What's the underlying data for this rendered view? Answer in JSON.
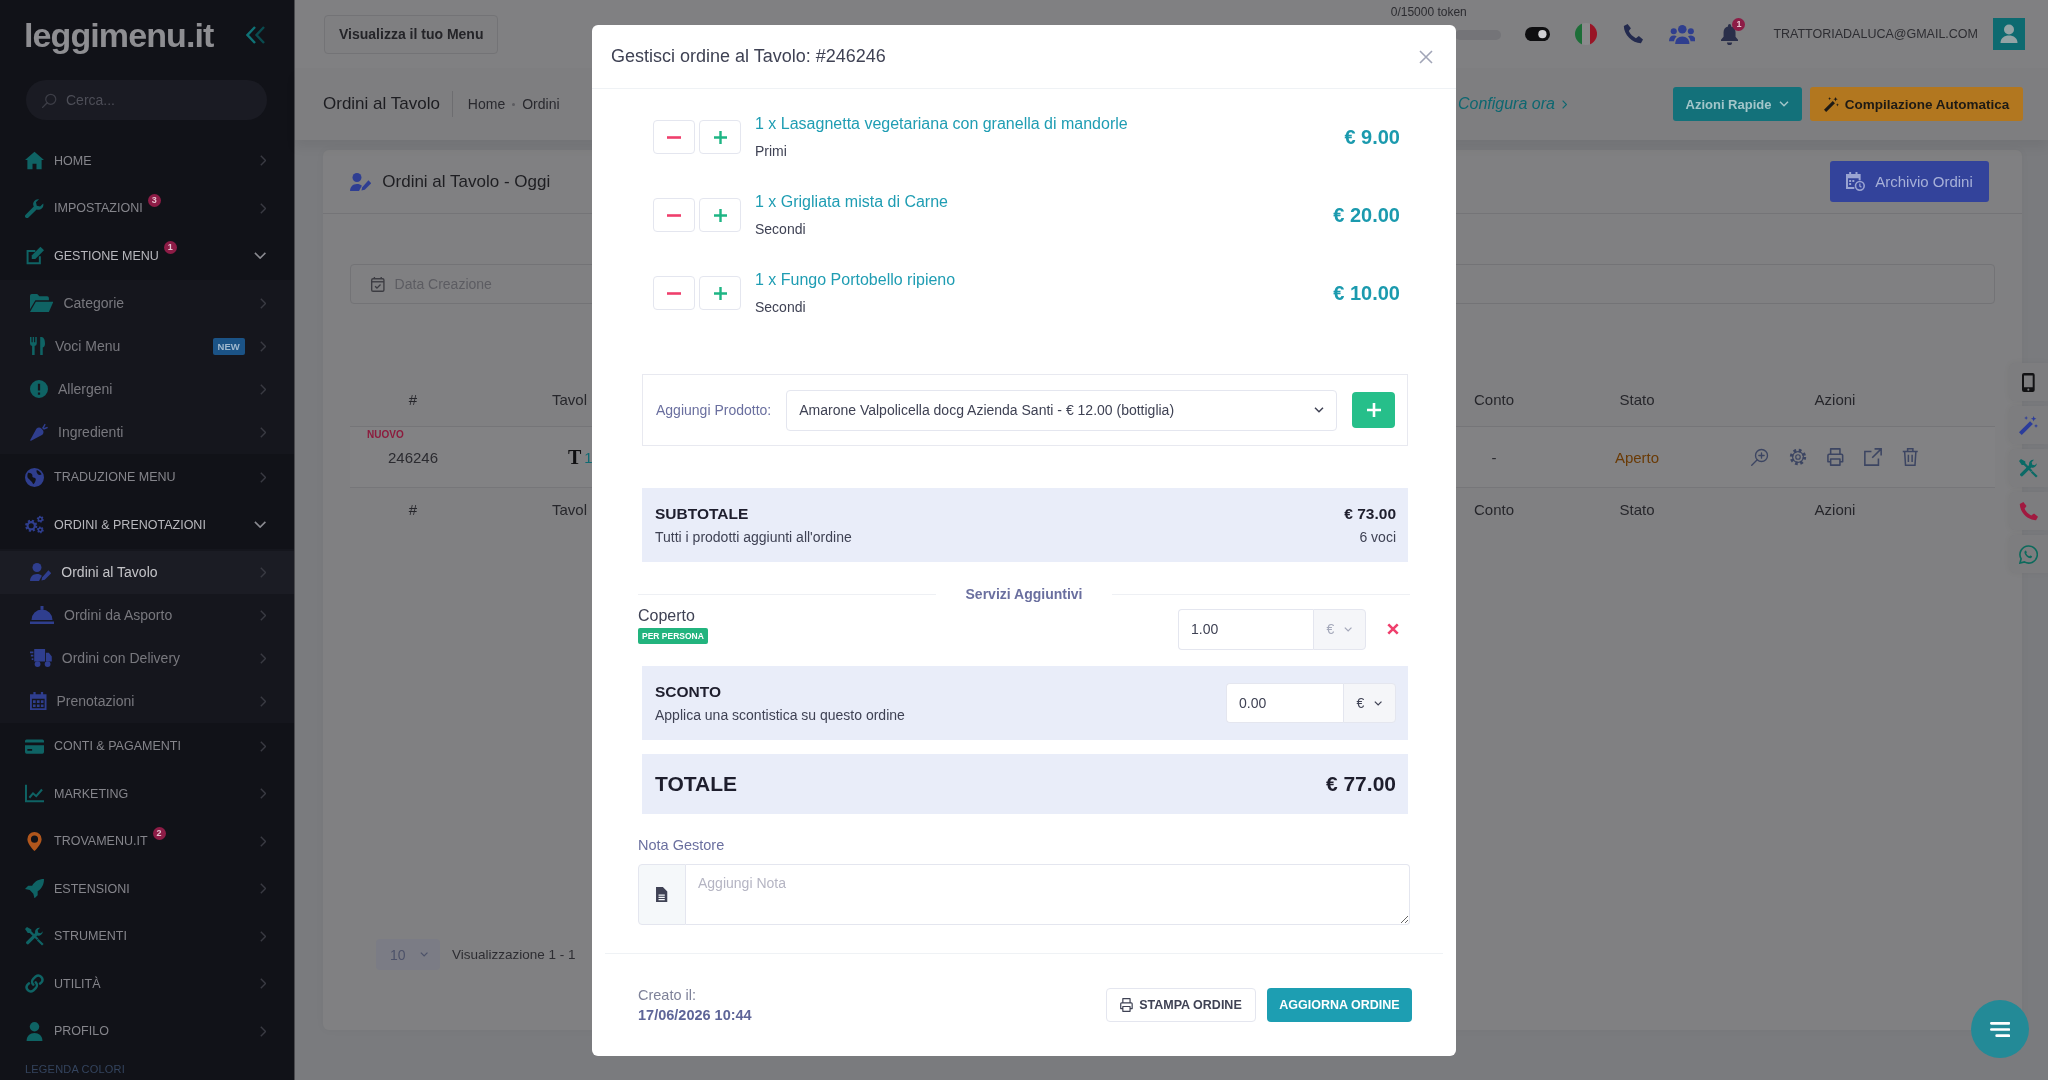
{
  "sidebar": {
    "logo": "leggimenu.it",
    "search": {
      "placeholder": "Cerca..."
    },
    "items": [
      {
        "label": "HOME",
        "selected": false,
        "expanded": false
      },
      {
        "label": "IMPOSTAZIONI",
        "badge": "3",
        "selected": false,
        "expanded": false
      },
      {
        "label": "GESTIONE MENU",
        "badge": "1",
        "selected": false,
        "expanded": true,
        "children": [
          {
            "label": "Categorie",
            "selected": false
          },
          {
            "label": "Voci Menu",
            "tag": "NEW",
            "selected": false
          },
          {
            "label": "Allergeni",
            "selected": false
          },
          {
            "label": "Ingredienti",
            "selected": false
          }
        ]
      },
      {
        "label": "TRADUZIONE MENU",
        "selected": false,
        "expanded": false
      },
      {
        "label": "ORDINI & PRENOTAZIONI",
        "selected": false,
        "expanded": true,
        "children": [
          {
            "label": "Ordini al Tavolo",
            "selected": true
          },
          {
            "label": "Ordini da Asporto",
            "selected": false
          },
          {
            "label": "Ordini con Delivery",
            "selected": false
          },
          {
            "label": "Prenotazioni",
            "selected": false
          }
        ]
      },
      {
        "label": "CONTI & PAGAMENTI",
        "selected": false,
        "expanded": false
      },
      {
        "label": "MARKETING",
        "selected": false,
        "expanded": false
      },
      {
        "label": "TROVAMENU.IT",
        "badge": "2",
        "selected": false,
        "expanded": false
      },
      {
        "label": "ESTENSIONI",
        "selected": false,
        "expanded": false
      },
      {
        "label": "STRUMENTI",
        "selected": false,
        "expanded": false
      },
      {
        "label": "UTILITÀ",
        "selected": false,
        "expanded": false
      },
      {
        "label": "PROFILO",
        "selected": false,
        "expanded": false
      }
    ],
    "section_heading": "LEGENDA COLORI"
  },
  "topbar": {
    "view_menu_button": "Visualizza il tuo Menu",
    "token_usage": {
      "label": "0/15000 token",
      "level": 0
    },
    "theme_toggle": {
      "on": true
    },
    "notifications": {
      "count": "1"
    },
    "user_email": "TRATTORIADALUCA@GMAIL.COM"
  },
  "page_header": {
    "title": "Ordini al Tavolo",
    "breadcrumb": [
      "Home",
      "Ordini"
    ],
    "notice_link": "Configura ora",
    "quick_actions_button": "Azioni Rapide",
    "autofill_button": "Compilazione Automatica"
  },
  "orders_card": {
    "title": "Ordini al Tavolo - Oggi",
    "archive_button": "Archivio Ordini",
    "date_filter": {
      "placeholder": "Data Creazione"
    },
    "table": {
      "columns": [
        "#",
        "Tavol",
        "Conto",
        "Stato",
        "Azioni"
      ],
      "rows": [
        {
          "badge": "NUOVO",
          "number": "246246",
          "table_marker": "T",
          "table_number": "1",
          "bill": "-",
          "status": "Aperto"
        }
      ],
      "footer_columns": [
        "#",
        "Tavol",
        "Conto",
        "Stato",
        "Azioni"
      ]
    },
    "pagination": {
      "page_size": "10",
      "info": "Visualizzazione 1 - 1"
    }
  },
  "order_dialog": {
    "title": "Gestisci ordine al Tavolo: #246246",
    "items": [
      {
        "name": "1 x Lasagnetta vegetariana con granella di mandorle",
        "category": "Primi",
        "price": "€ 9.00"
      },
      {
        "name": "1 x Grigliata mista di Carne",
        "category": "Secondi",
        "price": "€ 20.00"
      },
      {
        "name": "1 x Fungo Portobello ripieno",
        "category": "Secondi",
        "price": "€ 10.00"
      }
    ],
    "add_product": {
      "label": "Aggiungi Prodotto:",
      "selected_product": "Amarone Valpolicella docg Azienda Santi - € 12.00 (bottiglia)"
    },
    "subtotal": {
      "label": "SUBTOTALE",
      "description": "Tutti i prodotti aggiunti all'ordine",
      "amount": "€ 73.00",
      "count": "6 voci"
    },
    "extra_services": {
      "heading": "Servizi Aggiuntivi",
      "items": [
        {
          "name": "Coperto",
          "tag": "PER PERSONA",
          "value": "1.00",
          "currency": {
            "value": "€",
            "disabled": true
          }
        }
      ]
    },
    "discount": {
      "label": "SCONTO",
      "description": "Applica una scontistica su questo ordine",
      "value": "0.00",
      "currency": {
        "value": "€",
        "disabled": false
      }
    },
    "total": {
      "label": "TOTALE",
      "amount": "€ 77.00"
    },
    "note": {
      "label": "Nota Gestore",
      "placeholder": "Aggiungi Nota"
    },
    "created": {
      "label": "Creato il:",
      "value": "17/06/2026 10:44"
    },
    "buttons": [
      {
        "label": "STAMPA ORDINE",
        "kind": "outline"
      },
      {
        "label": "AGGIORNA ORDINE",
        "kind": "primary"
      }
    ]
  }
}
